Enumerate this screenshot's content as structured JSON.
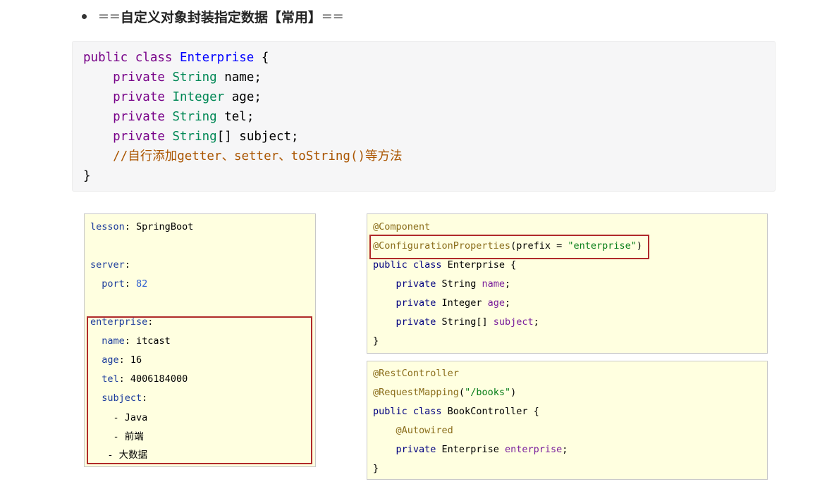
{
  "heading": {
    "prefix": "==",
    "title": "自定义对象封装指定数据【常用】",
    "suffix": "=="
  },
  "main_code": {
    "line1": {
      "kw": "public class",
      "name": "Enterprise",
      "rest": " {"
    },
    "line2": {
      "kw": "private",
      "type": "String",
      "rest": " name;"
    },
    "line3": {
      "kw": "private",
      "type": "Integer",
      "rest": " age;"
    },
    "line4": {
      "kw": "private",
      "type": "String",
      "rest": " tel;"
    },
    "line5": {
      "kw": "private",
      "type": "String",
      "rest": "[] subject;"
    },
    "line6": {
      "comment": "//自行添加getter、setter、toString()等方法"
    },
    "line7": "}"
  },
  "yaml": {
    "lesson_key": "lesson",
    "lesson_val": "SpringBoot",
    "server_key": "server",
    "port_key": "port",
    "port_val": "82",
    "enterprise_key": "enterprise",
    "name_key": "name",
    "name_val": "itcast",
    "age_key": "age",
    "age_val": "16",
    "tel_key": "tel",
    "tel_val": "4006184000",
    "subject_key": "subject",
    "subjects": [
      "Java",
      "前端",
      "大数据"
    ]
  },
  "entity_code": {
    "ann1": "@Component",
    "ann2": "@ConfigurationProperties",
    "ann2_open": "(prefix = ",
    "ann2_str": "\"enterprise\"",
    "ann2_close": ")",
    "class_kw": "public class",
    "class_name": " Enterprise {",
    "f1_kw": "private",
    "f1_type": " String ",
    "f1_name": "name",
    "f2_kw": "private",
    "f2_type": " Integer ",
    "f2_name": "age",
    "f3_kw": "private",
    "f3_type": " String[] ",
    "f3_name": "subject",
    "semi": ";",
    "close": "}"
  },
  "controller_code": {
    "ann1": "@RestController",
    "ann2": "@RequestMapping",
    "ann2_open": "(",
    "ann2_str": "\"/books\"",
    "ann2_close": ")",
    "class_kw": "public class",
    "class_name": " BookController {",
    "ann3": "@Autowired",
    "f_kw": "private",
    "f_type": " Enterprise ",
    "f_name": "enterprise",
    "semi": ";",
    "close": "}"
  }
}
